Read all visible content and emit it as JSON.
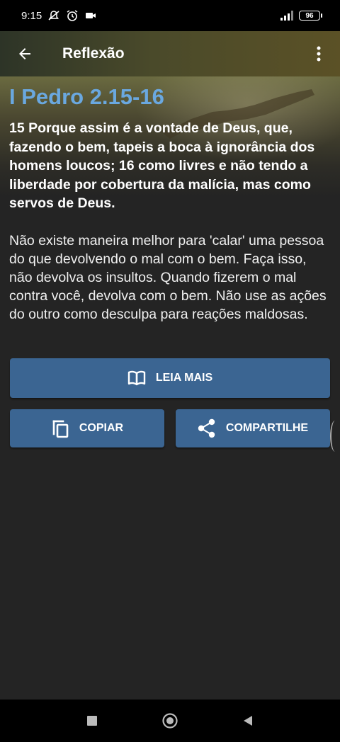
{
  "status_bar": {
    "time": "9:15",
    "battery": "96"
  },
  "header": {
    "title": "Reflexão"
  },
  "reference": "I Pedro 2.15-16",
  "verse": "15 Porque assim é a vontade de Deus, que, fazendo o bem, tapeis a boca à ignorância dos homens loucos; 16 como livres e não tendo a liberdade por cobertura da malícia, mas como servos de Deus.",
  "reflection": "Não existe maneira melhor para 'calar' uma pessoa do que devolvendo o mal com o bem. Faça isso, não devolva os insultos. Quando fizerem o mal contra você, devolva com o bem. Não use as ações do outro como desculpa para reações maldosas.",
  "buttons": {
    "read_more": "LEIA MAIS",
    "copy": "COPIAR",
    "share": "COMPARTILHE"
  },
  "colors": {
    "accent": "#3b6592",
    "reference": "#6aa8e0",
    "background": "#242424"
  },
  "icons": [
    "back-arrow-icon",
    "more-vert-icon",
    "book-open-icon",
    "copy-icon",
    "share-icon"
  ]
}
